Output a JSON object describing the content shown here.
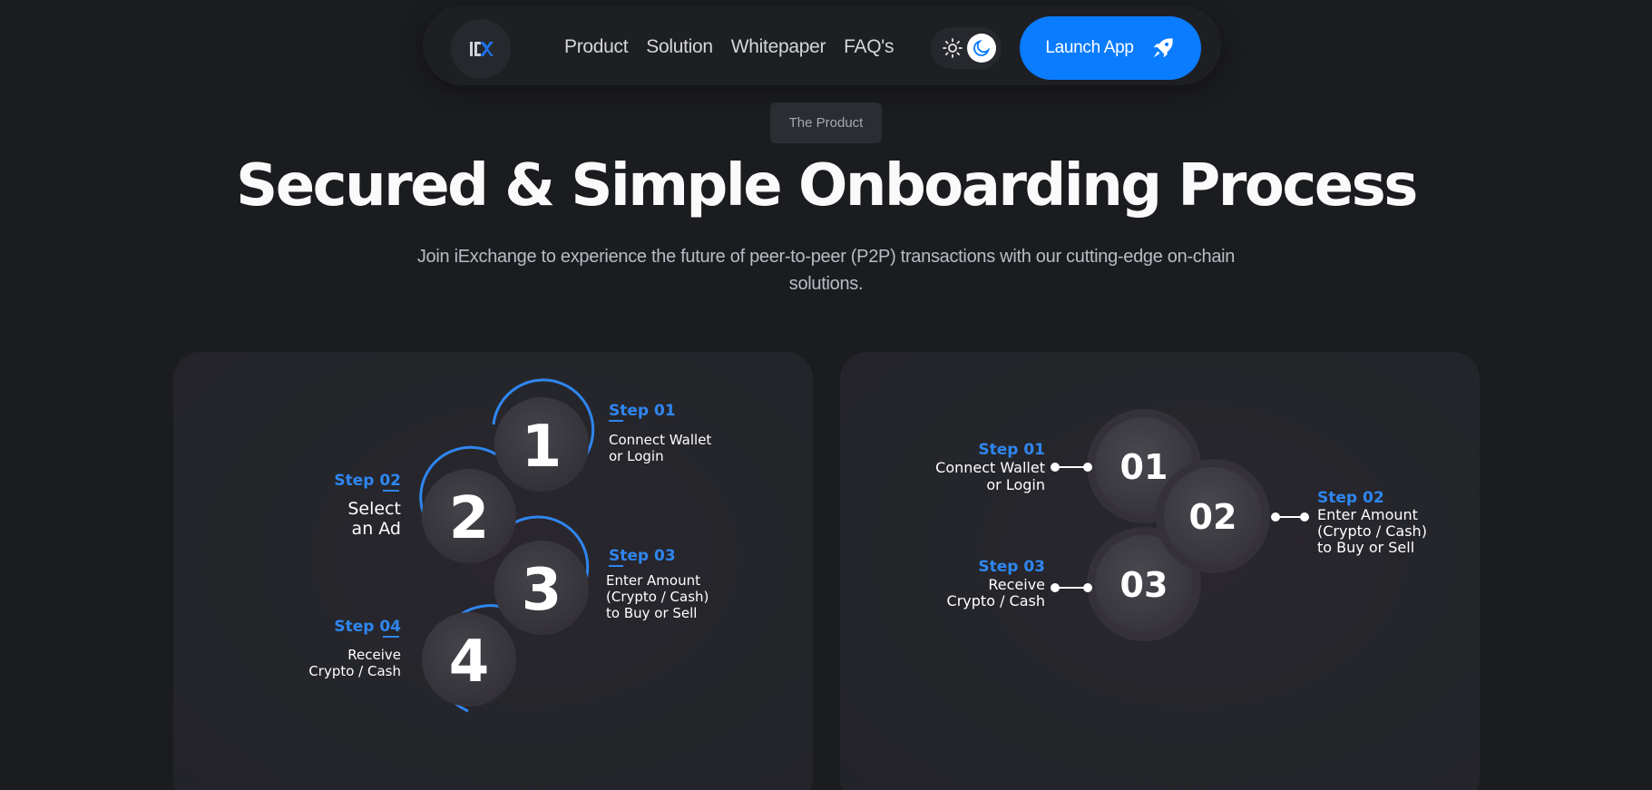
{
  "nav": {
    "links": [
      "Product",
      "Solution",
      "Whitepaper",
      "FAQ's"
    ],
    "launch_label": "Launch App",
    "icons": {
      "logo": "iexchange-logo",
      "sun": "sun-icon",
      "moon": "moon-icon",
      "rocket": "rocket-icon"
    }
  },
  "hero": {
    "badge": "The Product",
    "title": "Secured & Simple Onboarding Process",
    "subtitle": "Join iExchange to experience the future of peer-to-peer (P2P) transactions with our cutting-edge on-chain solutions."
  },
  "left_card": {
    "steps": [
      {
        "number": "1",
        "label": "Step 01",
        "lines": [
          "Connect Wallet",
          "or Login"
        ]
      },
      {
        "number": "2",
        "label": "Step 02",
        "lines": [
          "Select",
          "an Ad"
        ]
      },
      {
        "number": "3",
        "label": "Step 03",
        "lines": [
          "Enter Amount",
          "(Crypto / Cash)",
          "to Buy or Sell"
        ]
      },
      {
        "number": "4",
        "label": "Step 04",
        "lines": [
          "Receive",
          "Crypto / Cash"
        ]
      }
    ]
  },
  "right_card": {
    "steps": [
      {
        "number": "01",
        "label": "Step 01",
        "lines": [
          "Connect Wallet",
          "or Login"
        ]
      },
      {
        "number": "02",
        "label": "Step 02",
        "lines": [
          "Enter Amount",
          "(Crypto / Cash)",
          "to Buy or Sell"
        ]
      },
      {
        "number": "03",
        "label": "Step 03",
        "lines": [
          "Receive",
          "Crypto / Cash"
        ]
      }
    ]
  },
  "colors": {
    "accent": "#0a7cff",
    "step_label": "#2f86f0",
    "background": "#1b1c1f",
    "circle": "#3a3840"
  }
}
